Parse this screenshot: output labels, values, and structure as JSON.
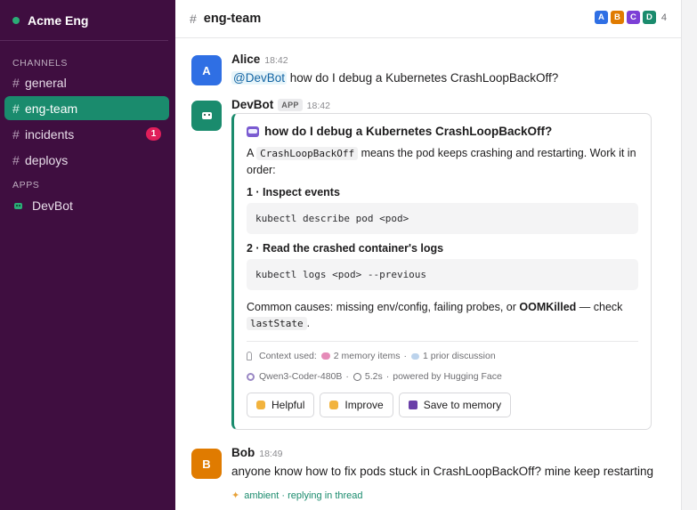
{
  "workspace": {
    "name": "Acme Eng",
    "status_color": "#2bac76"
  },
  "sidebar": {
    "channels_heading": "CHANNELS",
    "channels": [
      {
        "label": "general",
        "active": false
      },
      {
        "label": "eng-team",
        "active": true
      },
      {
        "label": "incidents",
        "active": false,
        "badge": "1"
      },
      {
        "label": "deploys",
        "active": false
      }
    ],
    "apps_heading": "APPS",
    "apps": [
      {
        "label": "DevBot",
        "icon": "bot-icon"
      }
    ]
  },
  "channel_header": {
    "hash": "#",
    "title": "eng-team",
    "member_avatars": [
      {
        "initial": "A",
        "color": "#2f6fe4"
      },
      {
        "initial": "B",
        "color": "#e07b00"
      },
      {
        "initial": "C",
        "color": "#7c3fd6"
      },
      {
        "initial": "D",
        "color": "#1a8b6d"
      }
    ],
    "member_count": "4"
  },
  "messages": {
    "alice": {
      "initial": "A",
      "avatar_color": "#2f6fe4",
      "author": "Alice",
      "time": "18:42",
      "mention": "@DevBot",
      "text": "how do I debug a Kubernetes CrashLoopBackOff?"
    },
    "devbot": {
      "author": "DevBot",
      "tag": "APP",
      "time": "18:42",
      "avatar_color": "#1a8b6d",
      "card": {
        "title": "how do I debug a Kubernetes CrashLoopBackOff?",
        "intro_pre": "A ",
        "intro_code": "CrashLoopBackOff",
        "intro_post": " means the pod keeps crashing and restarting. Work it in order:",
        "step1_title": "1 · Inspect events",
        "step1_code": "kubectl describe pod <pod>",
        "step2_title": "2 · Read the crashed container's logs",
        "step2_code": "kubectl logs <pod> --previous",
        "causes_pre": "Common causes: missing env/config, failing probes, or ",
        "causes_bold": "OOMKilled",
        "causes_post": " — check ",
        "causes_code": "lastState",
        "causes_end": ".",
        "context_label": "Context used:",
        "context_memory": "2 memory items",
        "context_sep": "·",
        "context_discussion": "1 prior discussion",
        "model": "Qwen3-Coder-480B",
        "latency": "5.2s",
        "powered": "powered by Hugging Face",
        "buttons": {
          "helpful": "Helpful",
          "improve": "Improve",
          "save": "Save to memory"
        }
      }
    },
    "bob": {
      "initial": "B",
      "avatar_color": "#e07b00",
      "author": "Bob",
      "time": "18:49",
      "text": "anyone know how to fix pods stuck in CrashLoopBackOff? mine keep restarting",
      "ambient": "ambient · replying in thread"
    }
  }
}
